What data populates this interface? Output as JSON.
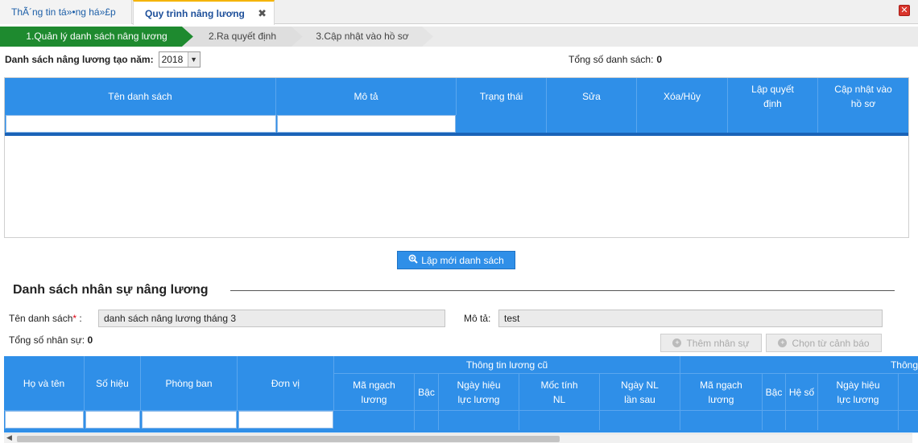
{
  "tabs": {
    "tab1": "ThÃ´ng tin tá»•ng há»£p",
    "tab2": "Quy trình nâng lương",
    "close_x": "✖"
  },
  "window_close": "✕",
  "steps": [
    "1.Quản lý danh sách nâng lương",
    "2.Ra quyết định",
    "3.Cập nhật vào hồ sơ"
  ],
  "filter": {
    "year_label": "Danh sách nâng lương tạo năm:",
    "year_value": "2018",
    "total_label": "Tổng số danh sách:",
    "total_value": "0"
  },
  "table1": {
    "columns": [
      "Tên danh sách",
      "Mô tả",
      "Trạng thái",
      "Sửa",
      "Xóa/Hủy",
      "Lập quyết định",
      "Cập nhật vào hồ sơ"
    ]
  },
  "new_list_button": "Lập mới danh sách",
  "section_title": "Danh sách nhân sự nâng lương",
  "form": {
    "name_label": "Tên danh sách",
    "name_req": "*",
    "name_colon": " :",
    "name_value": "danh sách nâng lương tháng 3",
    "desc_label": "Mô tả:",
    "desc_value": "test",
    "staff_total_label": "Tổng số nhân sự:",
    "staff_total_value": "0"
  },
  "buttons": {
    "add_staff": "Thêm nhân sự",
    "choose_warning": "Chọn từ cảnh báo"
  },
  "table2": {
    "fixed_columns": [
      "Họ và tên",
      "Số hiệu",
      "Phòng ban",
      "Đơn vị"
    ],
    "group_old": "Thông tin lương cũ",
    "group_new": "Thông",
    "old_columns": [
      "Mã ngạch lương",
      "Bậc",
      "Ngày hiệu lực lương",
      "Mốc tính NL",
      "Ngày NL lần sau"
    ],
    "new_columns": [
      "Mã ngạch lương",
      "Bậc",
      "Hệ số",
      "Ngày hiệu lực lương"
    ]
  },
  "icons": {
    "search": "zoom-in-icon",
    "plus": "plus-circle-icon"
  },
  "colors": {
    "header_blue": "#2f8fe8",
    "step_green": "#1e8a2f"
  }
}
